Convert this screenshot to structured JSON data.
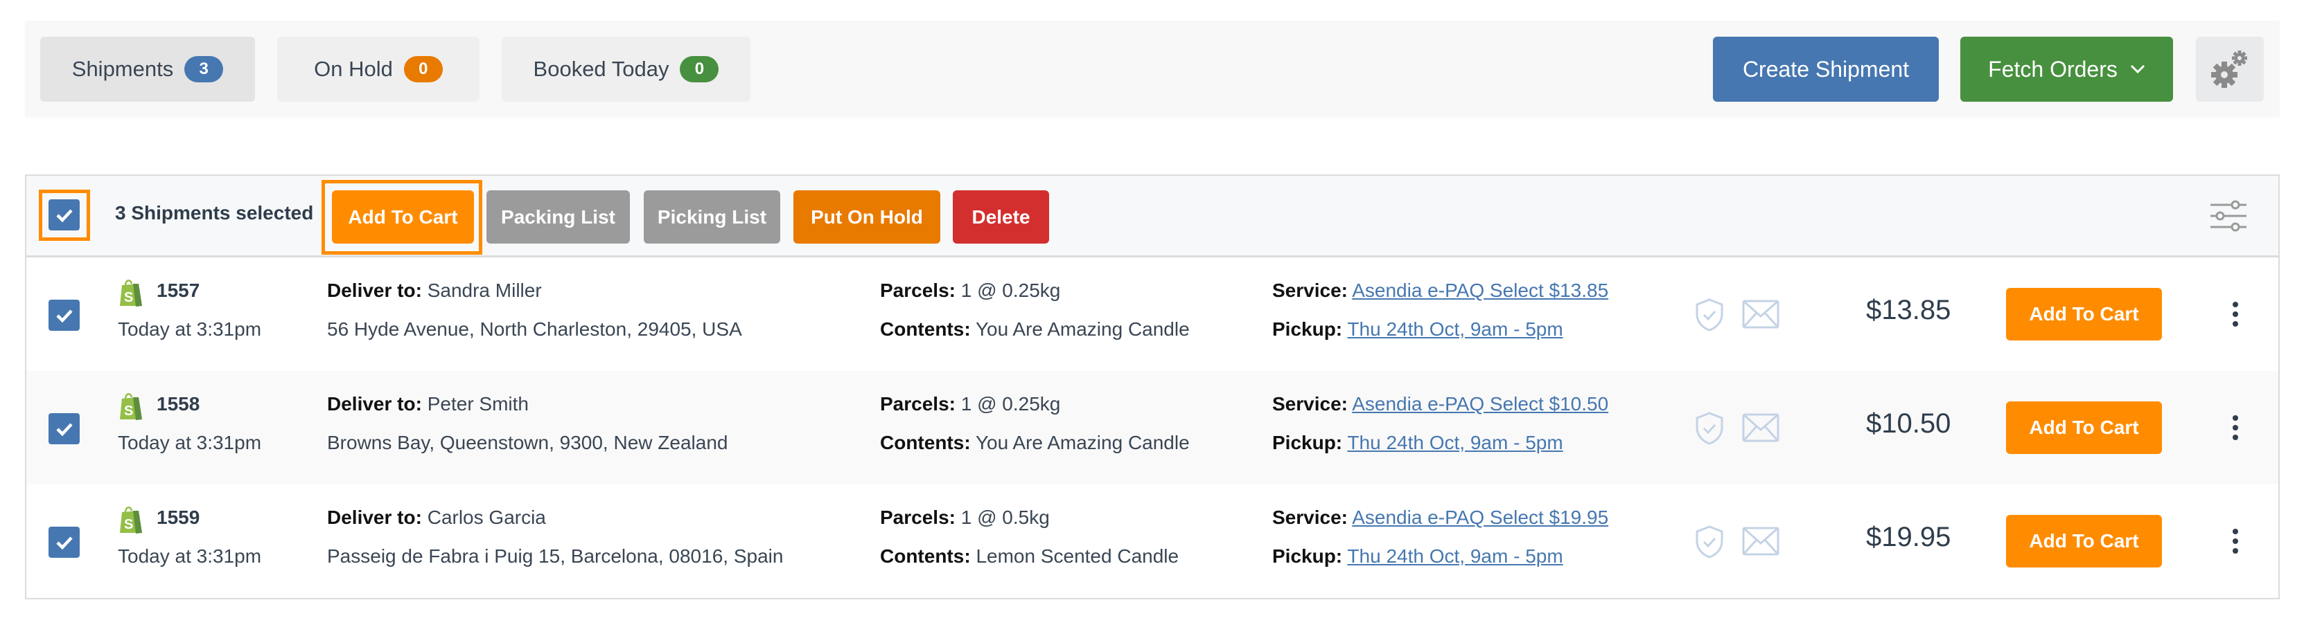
{
  "tabs": [
    {
      "label": "Shipments",
      "count": "3",
      "color": "#4677b0",
      "active": true
    },
    {
      "label": "On Hold",
      "count": "0",
      "color": "#e87a00",
      "active": false
    },
    {
      "label": "Booked Today",
      "count": "0",
      "color": "#47903f",
      "active": false
    }
  ],
  "header": {
    "create_label": "Create Shipment",
    "fetch_label": "Fetch Orders",
    "settings_icon": "gears-icon"
  },
  "toolbar": {
    "selected_text": "3 Shipments selected",
    "select_all_checked": true,
    "add_to_cart": "Add To Cart",
    "packing_list": "Packing List",
    "picking_list": "Picking List",
    "put_on_hold": "Put On Hold",
    "delete": "Delete",
    "filter_icon": "sliders-icon"
  },
  "labels": {
    "deliver_to": "Deliver to:",
    "parcels": "Parcels:",
    "contents": "Contents:",
    "service": "Service:",
    "pickup": "Pickup:",
    "row_button": "Add To Cart"
  },
  "shipments": [
    {
      "checked": true,
      "order": "1557",
      "time": "Today at 3:31pm",
      "name": "Sandra Miller",
      "address": "56 Hyde Avenue, North Charleston, 29405, USA",
      "parcels": "1 @ 0.25kg",
      "contents": "You Are Amazing Candle",
      "service": "Asendia e-PAQ Select $13.85",
      "pickup": "Thu 24th Oct, 9am - 5pm",
      "price": "$13.85"
    },
    {
      "checked": true,
      "order": "1558",
      "time": "Today at 3:31pm",
      "name": "Peter Smith",
      "address": "Browns Bay, Queenstown, 9300, New Zealand",
      "parcels": "1 @ 0.25kg",
      "contents": "You Are Amazing Candle",
      "service": "Asendia e-PAQ Select $10.50",
      "pickup": "Thu 24th Oct, 9am - 5pm",
      "price": "$10.50"
    },
    {
      "checked": true,
      "order": "1559",
      "time": "Today at 3:31pm",
      "name": "Carlos Garcia",
      "address": "Passeig de Fabra i Puig 15, Barcelona, 08016, Spain",
      "parcels": "1 @ 0.5kg",
      "contents": "Lemon Scented Candle",
      "service": "Asendia e-PAQ Select $19.95",
      "pickup": "Thu 24th Oct, 9am - 5pm",
      "price": "$19.95"
    }
  ]
}
